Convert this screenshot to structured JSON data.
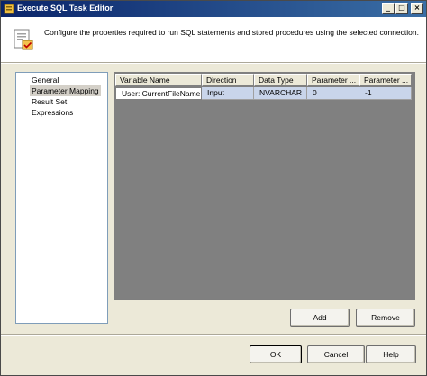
{
  "window": {
    "title": "Execute SQL Task Editor",
    "controls": {
      "minimize": "_",
      "maximize": "□",
      "close": "×"
    }
  },
  "header": {
    "icon": "sql-task-icon",
    "description": "Configure the properties required to run SQL statements and stored procedures using the selected connection."
  },
  "sidebar": {
    "items": [
      {
        "label": "General",
        "selected": false
      },
      {
        "label": "Parameter Mapping",
        "selected": true
      },
      {
        "label": "Result Set",
        "selected": false
      },
      {
        "label": "Expressions",
        "selected": false
      }
    ]
  },
  "grid": {
    "columns": [
      "Variable Name",
      "Direction",
      "Data Type",
      "Parameter ...",
      "Parameter ..."
    ],
    "rows": [
      [
        "User::CurrentFileName",
        "Input",
        "NVARCHAR",
        "0",
        "-1"
      ]
    ]
  },
  "buttons": {
    "add": "Add",
    "remove": "Remove",
    "ok": "OK",
    "cancel": "Cancel",
    "help": "Help"
  },
  "colors": {
    "titlebar_start": "#0a246a",
    "titlebar_end": "#3a6ea5",
    "dialog_bg": "#ece9d8",
    "grid_bg": "#808080",
    "row_highlight": "#c9d5ea"
  }
}
